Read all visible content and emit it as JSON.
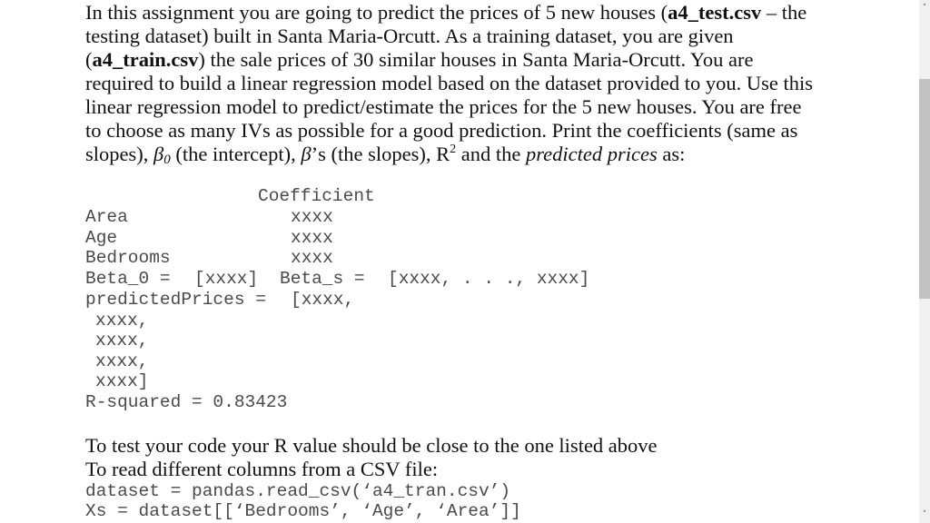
{
  "intro": {
    "line1": {
      "pre": "In this assignment you are going to predict the prices of 5 new houses (",
      "bold": "a4_test.csv",
      "post": " – the"
    },
    "line2": "testing dataset) built in Santa Maria-Orcutt. As a training dataset, you are given",
    "line3": {
      "pre": "(",
      "bold": "a4_train.csv",
      "post": ") the sale prices of 30 similar houses in Santa Maria-Orcutt. You are"
    },
    "line4": "required to build a linear regression model based on the dataset provided to you. Use this",
    "line5": "linear regression model to predict/estimate the prices for the 5 new houses. You are free",
    "line6": "to choose as many IVs as possible for a good prediction. Print the coefficients (same as",
    "line7": {
      "a": "slopes), ",
      "beta": "β",
      "sub0": "0",
      "b": " (the intercept), ",
      "beta2": "β",
      "c": "’s (the slopes), R",
      "sup": "2",
      "d": " and the ",
      "italic": "predicted prices",
      "e": " as:"
    }
  },
  "output_block": {
    "header": "Coefficient",
    "rows": [
      {
        "name": "Area",
        "value": "xxxx"
      },
      {
        "name": "Age",
        "value": "xxxx"
      },
      {
        "name": "Bedrooms",
        "value": "xxxx"
      }
    ],
    "beta0_label": "Beta_0 =",
    "beta0_value": "[xxxx]",
    "betas_label": "Beta_s =",
    "betas_value": "[xxxx, . . ., xxxx]",
    "predicted_label": "predictedPrices =",
    "predicted_first": "[xxxx,",
    "predicted_rest": [
      "xxxx,",
      "xxxx,",
      "xxxx,",
      "xxxx]"
    ],
    "rsquared": "R-squared = 0.83423"
  },
  "footer": {
    "line1": "To test your code your R value should be close to the one listed above",
    "line2": "To read different columns from a CSV file:",
    "code1": "dataset = pandas.read_csv(‘a4_tran.csv’)",
    "code2": "Xs = dataset[[‘Bedrooms’, ‘Age’, ‘Area’]]"
  },
  "scrollbar": {
    "up_icon": "˄",
    "down_icon": "˅",
    "position_fraction": 0.15
  }
}
